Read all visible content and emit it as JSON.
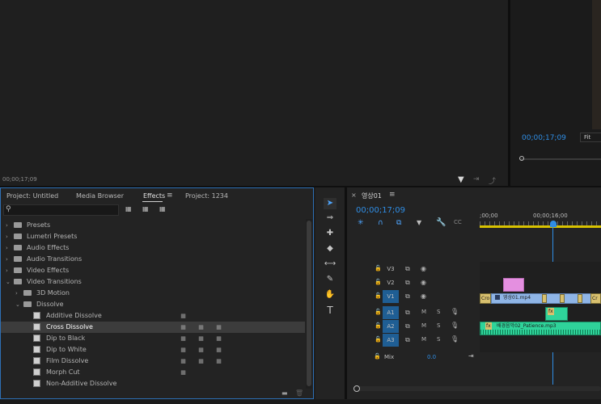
{
  "source_monitor": {
    "timecode": "00;00;17;09"
  },
  "program_monitor": {
    "timecode": "00;00;17;09",
    "zoom": "Fit"
  },
  "effects_panel": {
    "tabs": [
      {
        "label": "Project: Untitled",
        "active": false
      },
      {
        "label": "Media Browser",
        "active": false
      },
      {
        "label": "Effects",
        "active": true
      },
      {
        "label": "Project: 1234",
        "active": false
      }
    ],
    "search": {
      "placeholder": "",
      "value": ""
    },
    "tree": [
      {
        "label": "Presets",
        "depth": 0,
        "expanded": false,
        "kind": "preset-folder"
      },
      {
        "label": "Lumetri Presets",
        "depth": 0,
        "expanded": false,
        "kind": "preset-folder"
      },
      {
        "label": "Audio Effects",
        "depth": 0,
        "expanded": false,
        "kind": "folder"
      },
      {
        "label": "Audio Transitions",
        "depth": 0,
        "expanded": false,
        "kind": "folder"
      },
      {
        "label": "Video Effects",
        "depth": 0,
        "expanded": false,
        "kind": "folder"
      },
      {
        "label": "Video Transitions",
        "depth": 0,
        "expanded": true,
        "kind": "folder"
      },
      {
        "label": "3D Motion",
        "depth": 1,
        "expanded": false,
        "kind": "folder"
      },
      {
        "label": "Dissolve",
        "depth": 1,
        "expanded": true,
        "kind": "folder"
      },
      {
        "label": "Additive Dissolve",
        "depth": 2,
        "kind": "effect",
        "badges": 1,
        "selected": false
      },
      {
        "label": "Cross Dissolve",
        "depth": 2,
        "kind": "effect",
        "badges": 3,
        "selected": true
      },
      {
        "label": "Dip to Black",
        "depth": 2,
        "kind": "effect",
        "badges": 3,
        "selected": false
      },
      {
        "label": "Dip to White",
        "depth": 2,
        "kind": "effect",
        "badges": 3,
        "selected": false
      },
      {
        "label": "Film Dissolve",
        "depth": 2,
        "kind": "effect",
        "badges": 3,
        "selected": false
      },
      {
        "label": "Morph Cut",
        "depth": 2,
        "kind": "effect",
        "badges": 1,
        "selected": false
      },
      {
        "label": "Non-Additive Dissolve",
        "depth": 2,
        "kind": "effect",
        "badges": 0,
        "selected": false
      }
    ]
  },
  "timeline": {
    "sequence_name": "영상01",
    "timecode": "00;00;17;09",
    "ruler": {
      "start": ";00;00",
      "mid": "00;00;16;00"
    },
    "tracks": [
      {
        "id": "V3",
        "type": "video",
        "buttons": [
          "lock-icon",
          "film-icon",
          "eye-icon"
        ]
      },
      {
        "id": "V2",
        "type": "video",
        "buttons": [
          "lock-icon",
          "film-icon",
          "eye-icon"
        ]
      },
      {
        "id": "V1",
        "type": "video",
        "buttons": [
          "lock-icon",
          "film-icon",
          "eye-icon"
        ],
        "target": true
      },
      {
        "id": "A1",
        "type": "audio",
        "buttons": [
          "M",
          "S",
          "mic-icon"
        ],
        "target": true
      },
      {
        "id": "A2",
        "type": "audio",
        "buttons": [
          "M",
          "S",
          "mic-icon"
        ],
        "target": true
      },
      {
        "id": "A3",
        "type": "audio",
        "buttons": [
          "M",
          "S",
          "mic-icon"
        ],
        "target": true
      }
    ],
    "mix": {
      "label": "Mix",
      "value": "0.0"
    },
    "clips": {
      "v1_start": "Cro",
      "v1_main": "영상01.mp4",
      "v1_end": "Cr",
      "a2_main": "배경음악02_Patience.mp3",
      "fx": "fx"
    },
    "tool_text": "T"
  },
  "colors": {
    "accent": "#2f8de4",
    "video_clip": "#8fb5e6",
    "pink_clip": "#e48fe0",
    "audio_clip": "#2fd39a",
    "target_track": "#1f5e94"
  }
}
